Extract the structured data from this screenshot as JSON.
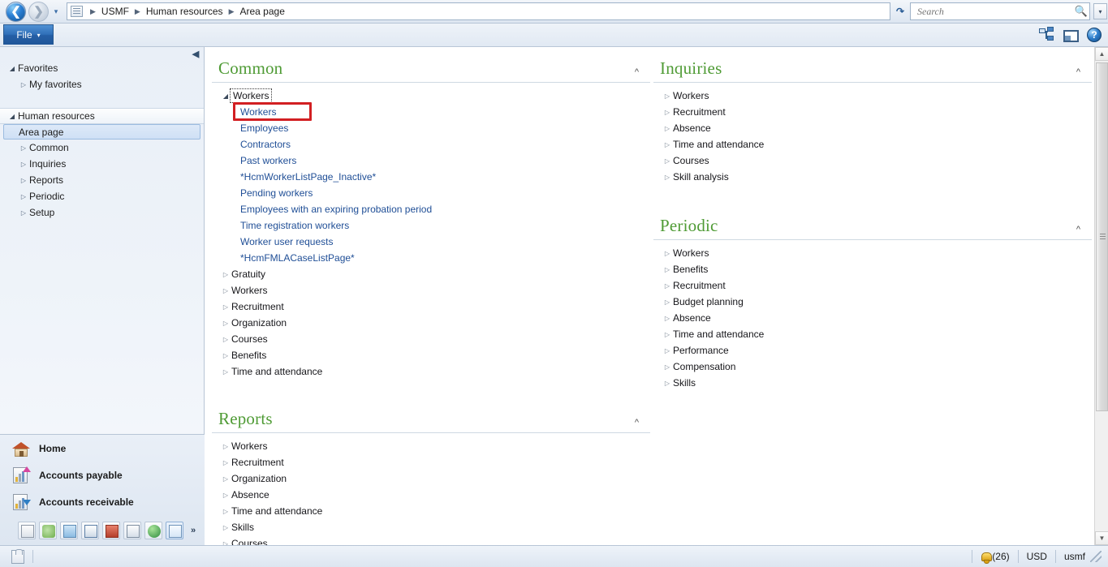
{
  "titlebar": {
    "back_icon": "back-arrow-icon",
    "forward_icon": "forward-arrow-icon",
    "history_caret": "▾",
    "address_icon": "address-book-icon",
    "breadcrumbs": [
      "USMF",
      "Human resources",
      "Area page"
    ],
    "separator": "▶",
    "refresh_icon": "refresh-icon",
    "search": {
      "placeholder": "Search",
      "value": "",
      "icon": "magnifier-icon",
      "caret": "▾"
    }
  },
  "ribbon": {
    "file_label": "File",
    "file_caret": "▾",
    "icons": [
      {
        "name": "related-information-icon"
      },
      {
        "name": "window-layout-icon"
      },
      {
        "name": "help-icon",
        "glyph": "?"
      }
    ]
  },
  "sidebar": {
    "collapse_icon": "◀",
    "favorites": {
      "label": "Favorites",
      "expander": "◢",
      "children": [
        {
          "label": "My favorites",
          "expander": "▷"
        }
      ]
    },
    "module": {
      "label": "Human resources",
      "expander": "◢",
      "children": [
        {
          "label": "Area page",
          "selected": true
        },
        {
          "label": "Common",
          "expander": "▷"
        },
        {
          "label": "Inquiries",
          "expander": "▷"
        },
        {
          "label": "Reports",
          "expander": "▷"
        },
        {
          "label": "Periodic",
          "expander": "▷"
        },
        {
          "label": "Setup",
          "expander": "▷"
        }
      ]
    },
    "modules": [
      {
        "label": "Home",
        "icon": "house-icon"
      },
      {
        "label": "Accounts payable",
        "icon": "accounts-payable-icon"
      },
      {
        "label": "Accounts receivable",
        "icon": "accounts-receivable-icon"
      }
    ],
    "module_strip": [
      {
        "icon": "budgeting-icon"
      },
      {
        "icon": "cost-accounting-icon"
      },
      {
        "icon": "fixed-assets-icon"
      },
      {
        "icon": "general-ledger-icon"
      },
      {
        "icon": "inventory-icon"
      },
      {
        "icon": "invoice-icon"
      },
      {
        "icon": "procurement-icon"
      },
      {
        "icon": "human-resources-icon",
        "active": true
      }
    ],
    "strip_overflow": "»"
  },
  "main": {
    "sections": [
      {
        "title": "Common",
        "chevron": "^",
        "column": "left",
        "groups": [
          {
            "label": "Workers",
            "expander": "◢",
            "expanded": true,
            "focused": true,
            "links": [
              {
                "label": "Workers",
                "highlighted": true
              },
              {
                "label": "Employees"
              },
              {
                "label": "Contractors"
              },
              {
                "label": "Past workers"
              },
              {
                "label": "*HcmWorkerListPage_Inactive*"
              },
              {
                "label": "Pending workers"
              },
              {
                "label": "Employees with an expiring probation period"
              },
              {
                "label": "Time registration workers"
              },
              {
                "label": "Worker user requests"
              },
              {
                "label": "*HcmFMLACaseListPage*"
              }
            ]
          },
          {
            "label": "Gratuity",
            "expander": "▷"
          },
          {
            "label": "Workers",
            "expander": "▷"
          },
          {
            "label": "Recruitment",
            "expander": "▷"
          },
          {
            "label": "Organization",
            "expander": "▷"
          },
          {
            "label": "Courses",
            "expander": "▷"
          },
          {
            "label": "Benefits",
            "expander": "▷"
          },
          {
            "label": "Time and attendance",
            "expander": "▷"
          }
        ]
      },
      {
        "title": "Reports",
        "chevron": "^",
        "column": "left",
        "groups": [
          {
            "label": "Workers",
            "expander": "▷"
          },
          {
            "label": "Recruitment",
            "expander": "▷"
          },
          {
            "label": "Organization",
            "expander": "▷"
          },
          {
            "label": "Absence",
            "expander": "▷"
          },
          {
            "label": "Time and attendance",
            "expander": "▷"
          },
          {
            "label": "Skills",
            "expander": "▷"
          },
          {
            "label": "Courses",
            "expander": "▷"
          }
        ]
      },
      {
        "title": "Inquiries",
        "chevron": "^",
        "column": "right",
        "groups": [
          {
            "label": "Workers",
            "expander": "▷"
          },
          {
            "label": "Recruitment",
            "expander": "▷"
          },
          {
            "label": "Absence",
            "expander": "▷"
          },
          {
            "label": "Time and attendance",
            "expander": "▷"
          },
          {
            "label": "Courses",
            "expander": "▷"
          },
          {
            "label": "Skill analysis",
            "expander": "▷"
          }
        ]
      },
      {
        "title": "Periodic",
        "chevron": "^",
        "column": "right",
        "groups": [
          {
            "label": "Workers",
            "expander": "▷"
          },
          {
            "label": "Benefits",
            "expander": "▷"
          },
          {
            "label": "Recruitment",
            "expander": "▷"
          },
          {
            "label": "Budget planning",
            "expander": "▷"
          },
          {
            "label": "Absence",
            "expander": "▷"
          },
          {
            "label": "Time and attendance",
            "expander": "▷"
          },
          {
            "label": "Performance",
            "expander": "▷"
          },
          {
            "label": "Compensation",
            "expander": "▷"
          },
          {
            "label": "Skills",
            "expander": "▷"
          }
        ]
      }
    ]
  },
  "scrollbar": {
    "up": "▲",
    "down": "▼"
  },
  "statusbar": {
    "left_icon": "attachment-icon",
    "notifications": {
      "icon": "bell-icon",
      "count": "(26)"
    },
    "currency": "USD",
    "company": "usmf"
  },
  "colors": {
    "section_title": "#4f9b35",
    "link": "#1f4e96",
    "highlight_box": "#d21f22",
    "chrome": "#e8eef7"
  }
}
